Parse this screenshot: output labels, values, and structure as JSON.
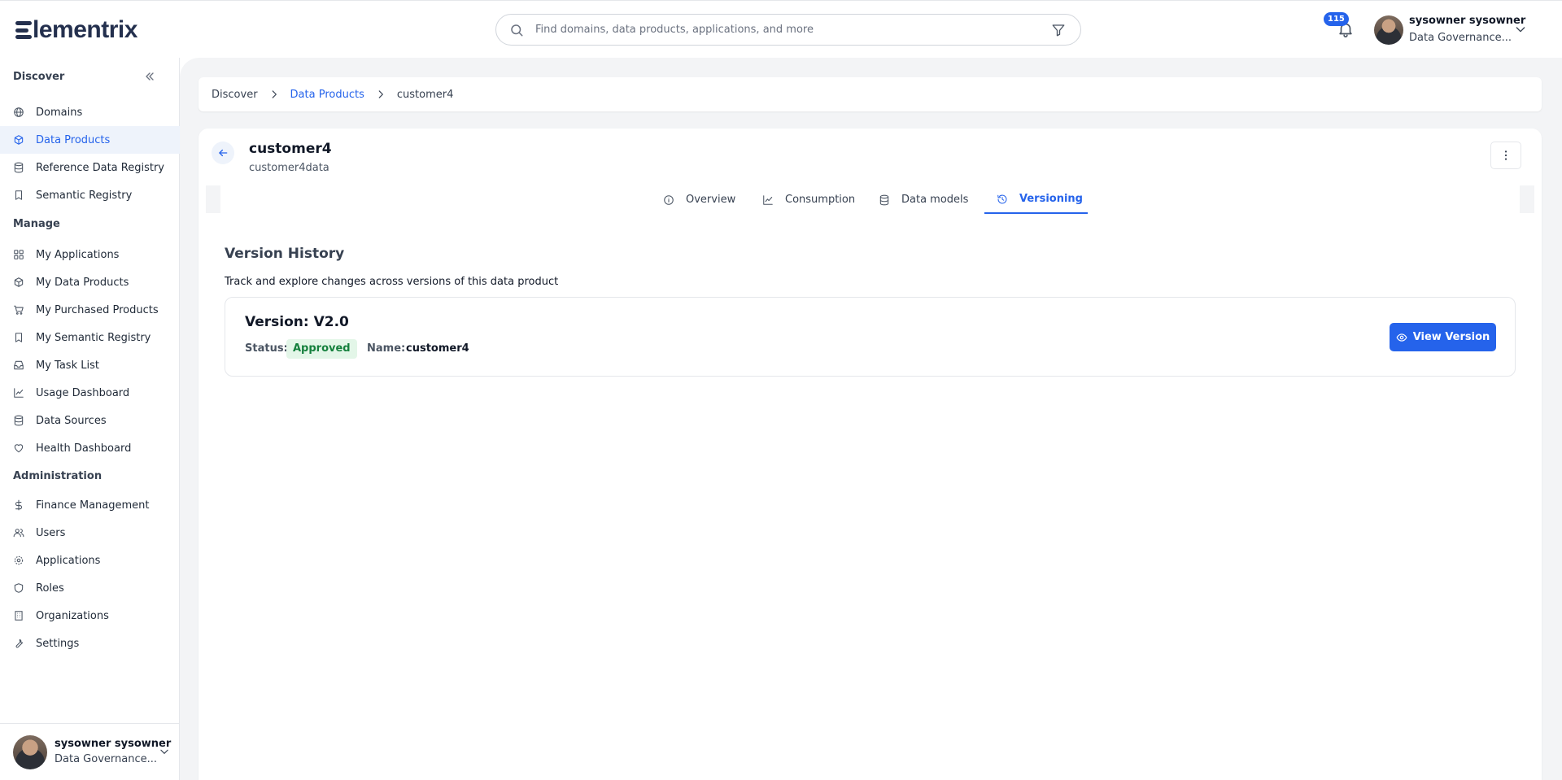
{
  "brand": {
    "logo_text": "lementrix"
  },
  "search": {
    "placeholder": "Find domains, data products, applications, and more"
  },
  "notifications": {
    "count": "115"
  },
  "user": {
    "name": "sysowner sysowner",
    "role": "Data Governance..."
  },
  "sidebar": {
    "discover_title": "Discover",
    "discover_items": [
      {
        "label": "Domains",
        "icon": "globe-icon"
      },
      {
        "label": "Data Products",
        "icon": "cube-icon",
        "active": true
      },
      {
        "label": "Reference Data Registry",
        "icon": "database-icon"
      },
      {
        "label": "Semantic Registry",
        "icon": "bookmark-icon"
      }
    ],
    "manage_title": "Manage",
    "manage_items": [
      {
        "label": "My Applications",
        "icon": "grid-icon"
      },
      {
        "label": "My Data Products",
        "icon": "cube-icon"
      },
      {
        "label": "My Purchased Products",
        "icon": "cart-icon"
      },
      {
        "label": "My Semantic Registry",
        "icon": "bookmark-icon"
      },
      {
        "label": "My Task List",
        "icon": "inbox-icon"
      },
      {
        "label": "Usage Dashboard",
        "icon": "chart-line-icon"
      },
      {
        "label": "Data Sources",
        "icon": "database-icon"
      },
      {
        "label": "Health Dashboard",
        "icon": "heart-icon"
      }
    ],
    "admin_title": "Administration",
    "admin_items": [
      {
        "label": "Finance Management",
        "icon": "dollar-icon"
      },
      {
        "label": "Users",
        "icon": "users-icon"
      },
      {
        "label": "Applications",
        "icon": "cog-icon"
      },
      {
        "label": "Roles",
        "icon": "shield-icon"
      },
      {
        "label": "Organizations",
        "icon": "building-icon"
      },
      {
        "label": "Settings",
        "icon": "wrench-icon"
      }
    ]
  },
  "breadcrumb": {
    "items": [
      "Discover",
      "Data Products",
      "customer4"
    ]
  },
  "product": {
    "title": "customer4",
    "subtitle": "customer4data"
  },
  "tabs": [
    {
      "label": "Overview",
      "icon": "info-icon"
    },
    {
      "label": "Consumption",
      "icon": "chart-line-icon"
    },
    {
      "label": "Data models",
      "icon": "database-icon"
    },
    {
      "label": "Versioning",
      "icon": "history-icon",
      "active": true
    }
  ],
  "version_history": {
    "title": "Version History",
    "subtitle": "Track and explore changes across versions of this data product",
    "versions": [
      {
        "title": "Version: V2.0",
        "status_label": "Status:",
        "status": "Approved",
        "name_label": "Name:",
        "name": "customer4",
        "action_label": "View Version"
      }
    ]
  },
  "colors": {
    "accent": "#2563eb",
    "active_bg": "#eef3fb",
    "approved_bg": "#e3f6e8",
    "approved_text": "#15803d",
    "brand": "#24304e"
  }
}
